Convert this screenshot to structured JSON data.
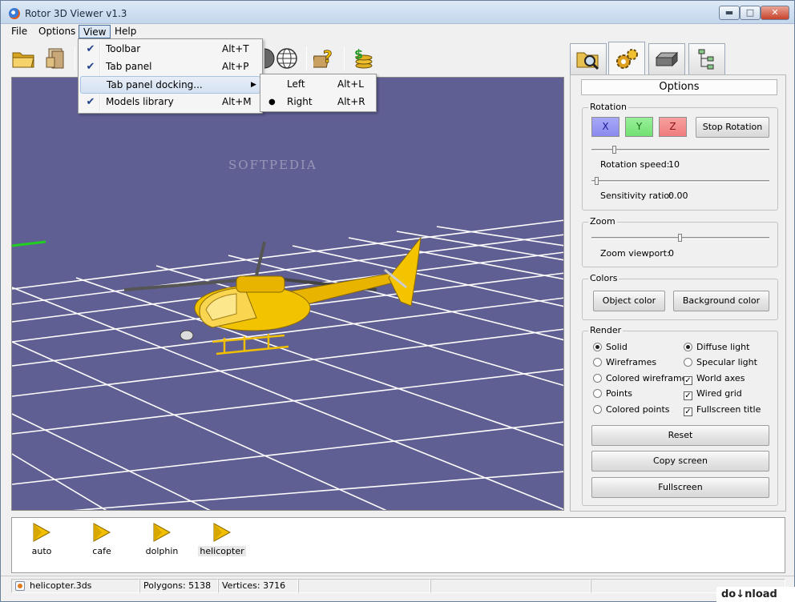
{
  "window": {
    "title": "Rotor 3D Viewer v1.3"
  },
  "menubar": {
    "file": "File",
    "options": "Options",
    "view": "View",
    "help": "Help"
  },
  "view_menu": [
    {
      "label": "Toolbar",
      "shortcut": "Alt+T",
      "checked": true
    },
    {
      "label": "Tab panel",
      "shortcut": "Alt+P",
      "checked": true
    },
    {
      "label": "Tab panel docking...",
      "shortcut": "",
      "checked": false,
      "submenu": true
    },
    {
      "label": "Models library",
      "shortcut": "Alt+M",
      "checked": true
    }
  ],
  "dock_submenu": [
    {
      "label": "Left",
      "shortcut": "Alt+L",
      "selected": false
    },
    {
      "label": "Right",
      "shortcut": "Alt+R",
      "selected": true
    }
  ],
  "toolbar_icons": [
    "open-folder-icon",
    "open-file-icon",
    "world-icon",
    "help-icon",
    "donate-icon"
  ],
  "right_tabs": [
    "browse-tab-icon",
    "options-tab-icon",
    "render-tab-icon",
    "scene-tab-icon"
  ],
  "viewport": {
    "background": "#605f94",
    "watermark": "SOFTPEDIA",
    "model_color": "#f0c000"
  },
  "options": {
    "title": "Options",
    "rotation": {
      "label": "Rotation",
      "x": "X",
      "y": "Y",
      "z": "Z",
      "stop": "Stop Rotation",
      "speed_label": "Rotation speed:",
      "speed_value": "10",
      "speed_fraction": 0.12,
      "sens_label": "Sensitivity ratio:",
      "sens_value": "0.00",
      "sens_fraction": 0.02
    },
    "zoom": {
      "label": "Zoom",
      "viewport_label": "Zoom viewport:",
      "value": "0",
      "fraction": 0.5
    },
    "colors": {
      "label": "Colors",
      "object": "Object color",
      "background": "Background color"
    },
    "render": {
      "label": "Render",
      "modes": [
        {
          "label": "Solid",
          "on": true
        },
        {
          "label": "Wireframes",
          "on": false
        },
        {
          "label": "Colored wireframes",
          "on": false
        },
        {
          "label": "Points",
          "on": false
        },
        {
          "label": "Colored points",
          "on": false
        }
      ],
      "lighting": [
        {
          "label": "Diffuse light",
          "on": true
        },
        {
          "label": "Specular light",
          "on": false
        }
      ],
      "flags": [
        {
          "label": "World axes",
          "on": true
        },
        {
          "label": "Wired grid",
          "on": true
        },
        {
          "label": "Fullscreen title",
          "on": true
        }
      ],
      "reset": "Reset",
      "copy": "Copy screen",
      "fullscreen": "Fullscreen"
    }
  },
  "library": [
    {
      "label": "auto",
      "selected": false
    },
    {
      "label": "cafe",
      "selected": false
    },
    {
      "label": "dolphin",
      "selected": false
    },
    {
      "label": "helicopter",
      "selected": true
    }
  ],
  "status": {
    "file": "helicopter.3ds",
    "polygons": "Polygons: 5138",
    "vertices": "Vertices: 3716"
  },
  "watermark_corner": "do↓nload"
}
